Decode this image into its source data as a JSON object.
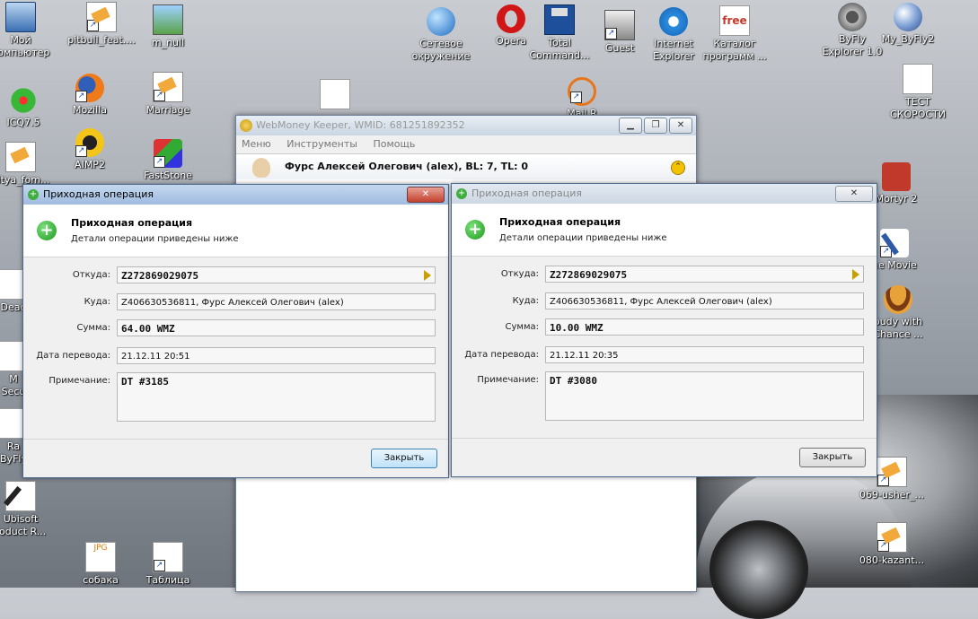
{
  "desktop_icons": [
    {
      "key": "computer",
      "label": "Мой\nкомпьютер",
      "glyph": "g-monitor"
    },
    {
      "key": "pitbull",
      "label": "pitbull_feat....",
      "glyph": "g-doc"
    },
    {
      "key": "mnull",
      "label": "m_null",
      "glyph": "g-img"
    },
    {
      "key": "network",
      "label": "Сетевое\nокружение",
      "glyph": "g-globe"
    },
    {
      "key": "opera",
      "label": "Opera",
      "glyph": "g-opera"
    },
    {
      "key": "totalcmd",
      "label": "Total\nCommand...",
      "glyph": "g-floppy"
    },
    {
      "key": "guest",
      "label": "Guest",
      "glyph": "g-user"
    },
    {
      "key": "ie",
      "label": "Internet\nExplorer",
      "glyph": "g-ie"
    },
    {
      "key": "catalog",
      "label": "Каталог\nпрограмм ...",
      "glyph": "g-free",
      "text": "free"
    },
    {
      "key": "byfly",
      "label": "ByFly\nExplorer 1.0",
      "glyph": "g-gray"
    },
    {
      "key": "mybyfly",
      "label": "My_ByFly2",
      "glyph": "g-blueball"
    },
    {
      "key": "icq",
      "label": "ICQ7.5",
      "glyph": "g-flower"
    },
    {
      "key": "mozilla",
      "label": "Mozilla",
      "glyph": "g-fox"
    },
    {
      "key": "marriage",
      "label": "Marriage",
      "glyph": "g-doc"
    },
    {
      "key": "test",
      "label": "ТЕСТ\nСКОРОСТИ",
      "glyph": "g-sheet"
    },
    {
      "key": "aimp",
      "label": "AIMP2",
      "glyph": "g-ring"
    },
    {
      "key": "faststone",
      "label": "FastStone",
      "glyph": "g-shield"
    },
    {
      "key": "nitya",
      "label": "nitya_fom...",
      "glyph": "g-doc"
    },
    {
      "key": "mortyr",
      "label": "Mortyr 2",
      "glyph": "g-red"
    },
    {
      "key": "freemovie",
      "label": "ee Movie",
      "glyph": "g-pen"
    },
    {
      "key": "moody",
      "label": "oudy with\nChance ...",
      "glyph": "g-burger"
    },
    {
      "key": "dead",
      "label": "Dead",
      "glyph": "g-sheet"
    },
    {
      "key": "secu",
      "label": "M\nSecu",
      "glyph": "g-sheet"
    },
    {
      "key": "rab",
      "label": "Ra\nByFly",
      "glyph": "g-sheet"
    },
    {
      "key": "usher",
      "label": "069-usher_...",
      "glyph": "g-doc"
    },
    {
      "key": "ubisoft",
      "label": "Ubisoft\nroduct R...",
      "glyph": "g-feather"
    },
    {
      "key": "kazant",
      "label": "080-kazant...",
      "glyph": "g-doc"
    },
    {
      "key": "sobaka",
      "label": "собака",
      "glyph": "g-jpg",
      "text": "JPG"
    },
    {
      "key": "tablica",
      "label": "Таблица",
      "glyph": "g-sheet"
    },
    {
      "key": "mailru",
      "label": "Mail.R",
      "glyph": "g-orange"
    },
    {
      "key": "cursorapp",
      "label": "",
      "glyph": "g-sheet"
    }
  ],
  "keeper": {
    "title": "WebMoney Keeper, WMID: 681251892352",
    "menu": [
      "Меню",
      "Инструменты",
      "Помощь"
    ],
    "user": "Фурс Алексей Олегович (alex), BL: 7, TL: 0"
  },
  "dialog_left": {
    "title": "Приходная операция",
    "heading": "Приходная операция",
    "subheading": "Детали операции приведены ниже",
    "from_label": "Откуда:",
    "from": "Z272869029075",
    "to_label": "Куда:",
    "to": "Z406630536811, Фурс Алексей Олегович (alex)",
    "sum_label": "Сумма:",
    "sum": "64.00 WMZ",
    "date_label": "Дата перевода:",
    "date": "21.12.11 20:51",
    "note_label": "Примечание:",
    "note": "DT #3185",
    "close": "Закрыть"
  },
  "dialog_right": {
    "title": "Приходная операция",
    "heading": "Приходная операция",
    "subheading": "Детали операции приведены ниже",
    "from_label": "Откуда:",
    "from": "Z272869029075",
    "to_label": "Куда:",
    "to": "Z406630536811, Фурс Алексей Олегович (alex)",
    "sum_label": "Сумма:",
    "sum": "10.00 WMZ",
    "date_label": "Дата перевода:",
    "date": "21.12.11 20:35",
    "note_label": "Примечание:",
    "note": "DT #3080",
    "close": "Закрыть"
  }
}
